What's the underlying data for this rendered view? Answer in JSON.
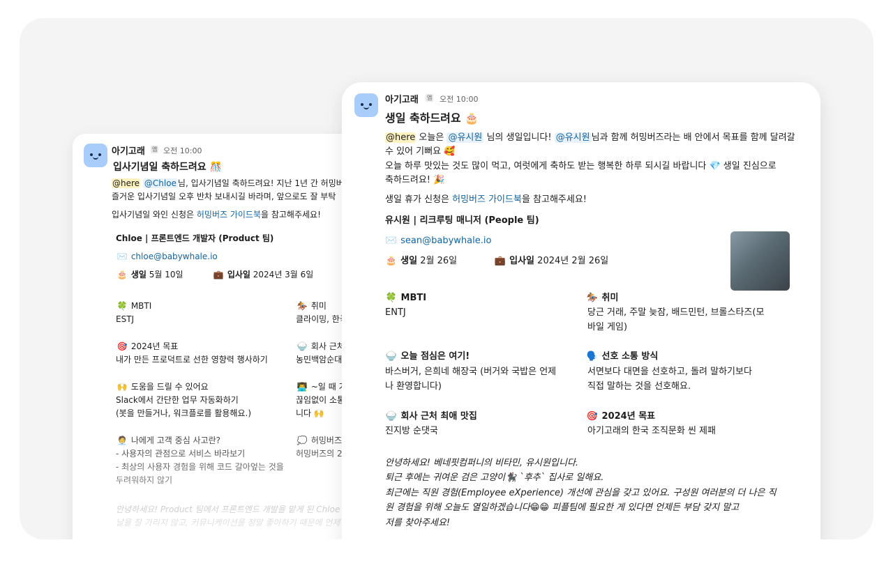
{
  "back_card": {
    "sender": "아기고래",
    "app_badge": "앱",
    "time": "오전 10:00",
    "title": "입사기념일 축하드려요 🎊",
    "here": "@here",
    "mention": "@Chloe",
    "line1_rest": "님, 입사기념일 축하드려요! 지난 1년 간 허밍버",
    "line2": "즐거운 입사기념일 오후 반차 보내시길 바라며, 앞으로도 잘 부탁",
    "guide_prefix": "입사기념일 와인 신청은 ",
    "guide_link": "허밍버즈 가이드북",
    "guide_suffix": "을 참고해주세요!",
    "profile_name": "Chloe | 프론트엔드 개발자 (Product 팀)",
    "email": "chloe@babywhale.io",
    "birthday_label": "생일",
    "birthday_value": "5월 10일",
    "join_label": "입사일",
    "join_value": "2024년 3월 6일",
    "fields": [
      {
        "icon": "🍀",
        "label": "MBTI",
        "value": "ESTJ"
      },
      {
        "icon": "🏇",
        "label": "취미",
        "value": "클라이밍, 한국"
      },
      {
        "icon": "🎯",
        "label": "2024년 목표",
        "value": "내가 만든 프로덕트로 선한 영향력 행사하기"
      },
      {
        "icon": "🍚",
        "label": "회사 근처",
        "value": "농민백암순대"
      },
      {
        "icon": "🙌",
        "label": "도움을 드릴 수 있어요",
        "value": "Slack에서 간단한 업무 자동화하기",
        "value2": "(봇을 만들거나, 워크플로를 활용해요.)"
      },
      {
        "icon": "👨‍💻",
        "label": "~일 때 가",
        "value": "끊임없이 소통",
        "value2": "니다 🙌"
      },
      {
        "icon": "🧑‍💼",
        "label": "나에게 고객 중심 사고란?",
        "value": "- 사용자의 관점으로 서비스 바라보기",
        "value2": "- 최상의 사용자 경험을 위해 코드 갈아엎는 것을",
        "value3": "두려워하지 않기"
      },
      {
        "icon": "💭",
        "label": "허밍버즈",
        "value": "허밍버즈의 2"
      }
    ],
    "intro1": "안녕하세요! Product 팀에서 프론트엔드 개발을 맡게 된 Chloe 입",
    "intro2": "날을 잘 가리지 않고, 커뮤니케이션을 정말 좋아하기 때문에 언제"
  },
  "front_card": {
    "sender": "아기고래",
    "app_badge": "앱",
    "time": "오전 10:00",
    "title": "생일 축하드려요 🎂",
    "here": "@here",
    "msg_a": " 오늘은 ",
    "mention1": "@유시원",
    "msg_b": " 님의 생일입니다! ",
    "mention2": "@유시원",
    "msg_c": "님과 함께 허밍버즈라는 배 안에서 목표를 함께 달려갈",
    "msg_line2": "수 있어 기뻐요 🥰",
    "msg_line3": "오늘 하루 맛있는 것도 많이 먹고, 여럿에게 축하도 받는 행복한 하루 되시길 바랍니다 💎 생일 진심으로",
    "msg_line4": "축하드려요! 🎉",
    "guide_prefix": "생일 휴가 신청은 ",
    "guide_link": "허밍버즈 가이드북",
    "guide_suffix": "을 참고해주세요!",
    "profile_name": "유시원 | 리크루팅 매니저 (People 팀)",
    "email": "sean@babywhale.io",
    "birthday_label": "생일",
    "birthday_value": "2월 26일",
    "join_label": "입사일",
    "join_value": "2024년 2월 26일",
    "fields": [
      {
        "icon": "🍀",
        "label": "MBTI",
        "value": "ENTJ"
      },
      {
        "icon": "🏇",
        "label": "취미",
        "value": "당근 거래, 주말 늦잠, 배드민턴, 브롤스타즈(모",
        "value2": "바일 게임)"
      },
      {
        "icon": "🍚",
        "label": "오늘 점심은 여기!",
        "value": "바스버거, 은희네 해장국 (버거와 국밥은 언제",
        "value2": "나 환영합니다)"
      },
      {
        "icon": "🗣️",
        "label": "선호 소통 방식",
        "value": "서면보다 대면을 선호하고, 돌려 말하기보다",
        "value2": "직접 말하는 것을 선호해요."
      },
      {
        "icon": "🍚",
        "label": "회사 근처 최애 맛집",
        "value": "진지방 순댓국"
      },
      {
        "icon": "🎯",
        "label": "2024년 목표",
        "value": "아기고래의 한국 조직문화 씬 제패"
      }
    ],
    "intro1": "안녕하세요! 베네핏컴퍼니의 비타민, 유시원입니다.",
    "intro2": "퇴근 후에는 귀여운 검은 고양이🐈‍⬛ `후추` 집사로 일해요.",
    "intro3": "최근에는 직원 경험(Employee eXperience) 개선에 관심을 갖고 있어요. 구성원 여러분의 더 나은 직",
    "intro4": "원 경험을 위해 오늘도 열일하겠습니다😁😁 피플팀에 필요한 게 있다면 언제든 부담 갖지 말고",
    "intro5": "저를 찾아주세요!"
  }
}
